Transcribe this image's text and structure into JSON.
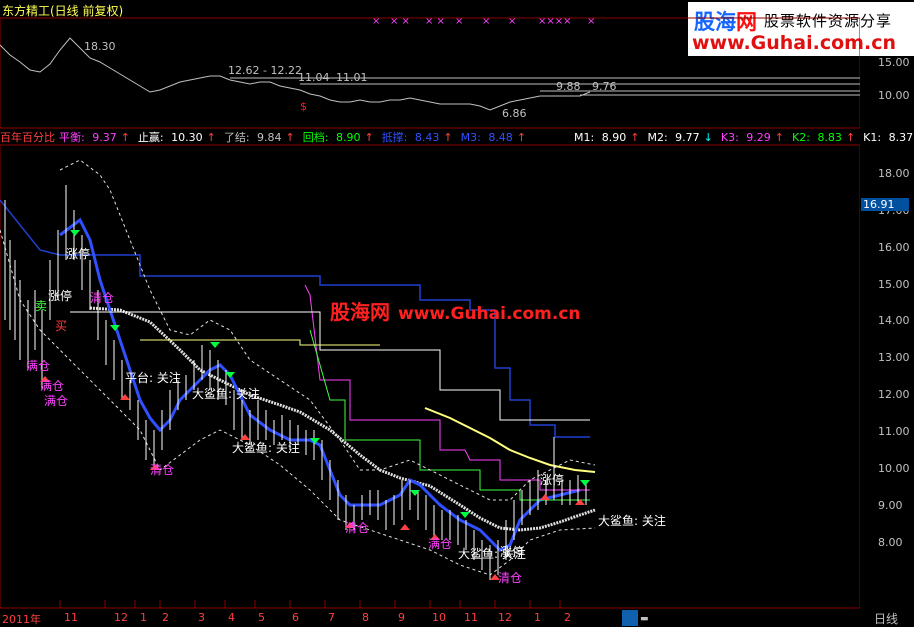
{
  "window": {
    "title": "东方精工(日线 前复权)"
  },
  "watermark": {
    "logo_left": "股海",
    "logo_right": "网",
    "slogan": "股票软件资源分享",
    "url": "www.Guhai.com.cn"
  },
  "main_watermark": {
    "text_cn": "股海网",
    "text_url": "www.Guhai.com.cn"
  },
  "top_chart": {
    "annotations": {
      "high": "18.30",
      "range1": "12.62 - 12.22",
      "v1": "11.04",
      "v2": "11.01",
      "v3": "9.88",
      "v4": "9.76",
      "low": "6.86",
      "marker": "$"
    },
    "yticks": [
      "15.00",
      "10.00"
    ]
  },
  "indicators": {
    "name": "百年百分比",
    "items": [
      {
        "label": "平衡:",
        "value": "9.37",
        "color": "#ff40ff",
        "arrow": "↑",
        "dir": "up"
      },
      {
        "label": "止赢:",
        "value": "10.30",
        "color": "#ffffff",
        "arrow": "↑",
        "dir": "up"
      },
      {
        "label": "了结:",
        "value": "9.84",
        "color": "#c0c0c0",
        "arrow": "↑",
        "dir": "up"
      },
      {
        "label": "回档:",
        "value": "8.90",
        "color": "#00ff00",
        "arrow": "↑",
        "dir": "up"
      },
      {
        "label": "抵撑:",
        "value": "8.43",
        "color": "#3050ff",
        "arrow": "↑",
        "dir": "up"
      },
      {
        "label": "M3:",
        "value": "8.48",
        "color": "#3050ff",
        "arrow": "↑",
        "dir": "up"
      },
      {
        "label": "M1:",
        "value": "8.90",
        "color": "#ffffff",
        "arrow": "↑",
        "dir": "up"
      },
      {
        "label": "M2:",
        "value": "9.77",
        "color": "#ffffff",
        "arrow": "↓",
        "dir": "dn"
      },
      {
        "label": "K3:",
        "value": "9.29",
        "color": "#ff40ff",
        "arrow": "↑",
        "dir": "up"
      },
      {
        "label": "K2:",
        "value": "8.83",
        "color": "#00ff00",
        "arrow": "↑",
        "dir": "up"
      },
      {
        "label": "K1:",
        "value": "8.37",
        "color": "#ffffff",
        "arrow": "↑",
        "dir": "up"
      },
      {
        "label": "K0",
        "value": "",
        "color": "#3050ff",
        "arrow": "",
        "dir": "up"
      }
    ]
  },
  "main_chart": {
    "yticks": [
      "18.00",
      "17.00",
      "16.00",
      "15.00",
      "14.00",
      "13.00",
      "12.00",
      "11.00",
      "10.00",
      "9.00",
      "8.00"
    ],
    "current_price": "16.91",
    "labels": {
      "limit_up": "涨停",
      "full_pos": "满仓",
      "sell": "卖",
      "buy": "买",
      "wait": "观望",
      "shark": "大鲨鱼: 关注",
      "platform": "平台: 关注",
      "empty": "清仓",
      "heavy": "满仓"
    }
  },
  "date_axis": {
    "labels": [
      "2011年",
      "11",
      "12",
      "1",
      "2",
      "3",
      "4",
      "5",
      "6",
      "7",
      "8",
      "9",
      "10",
      "11",
      "12",
      "1",
      "2"
    ],
    "period": "日线"
  },
  "colors": {
    "up": "#ff4040",
    "down": "#00ffff",
    "grid": "#8b0000",
    "ma_white": "#ffffff",
    "ma_yellow": "#ffff80",
    "ma_blue": "#2040d0",
    "ma_magenta": "#ff40ff",
    "ma_green": "#40ff40"
  }
}
